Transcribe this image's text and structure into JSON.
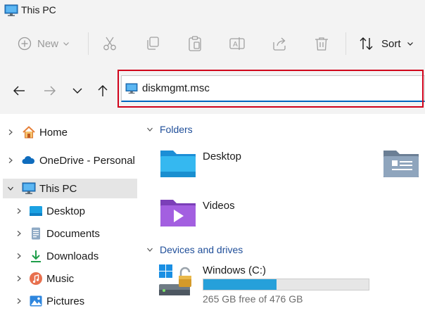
{
  "window": {
    "title": "This PC"
  },
  "toolbar": {
    "new_label": "New",
    "sort_label": "Sort",
    "icons": [
      "cut-icon",
      "copy-icon",
      "paste-icon",
      "rename-icon",
      "share-icon",
      "delete-icon"
    ]
  },
  "navigation": {
    "address_value": "diskmgmt.msc",
    "address_highlight_color": "#d0021b"
  },
  "sidebar": {
    "items": [
      {
        "label": "Home",
        "icon": "home-icon"
      },
      {
        "label": "OneDrive - Personal",
        "icon": "cloud-icon"
      },
      {
        "label": "This PC",
        "icon": "computer-icon"
      },
      {
        "label": "Desktop",
        "icon": "desktop-icon"
      },
      {
        "label": "Documents",
        "icon": "documents-icon"
      },
      {
        "label": "Downloads",
        "icon": "downloads-icon"
      },
      {
        "label": "Music",
        "icon": "music-icon"
      },
      {
        "label": "Pictures",
        "icon": "pictures-icon"
      }
    ]
  },
  "main": {
    "folders_heading": "Folders",
    "folders": [
      {
        "name": "Desktop",
        "icon": "desktop-folder-icon"
      },
      {
        "name": "Videos",
        "icon": "videos-folder-icon"
      }
    ],
    "devices_heading": "Devices and drives",
    "drives": [
      {
        "name": "Windows (C:)",
        "free_text": "265 GB free of 476 GB",
        "used_fraction": 0.443,
        "icon": "windows-drive-icon"
      }
    ]
  },
  "colors": {
    "accent": "#0067c0",
    "drive_bar": "#26a0da",
    "section_heading": "#1f4e99"
  }
}
